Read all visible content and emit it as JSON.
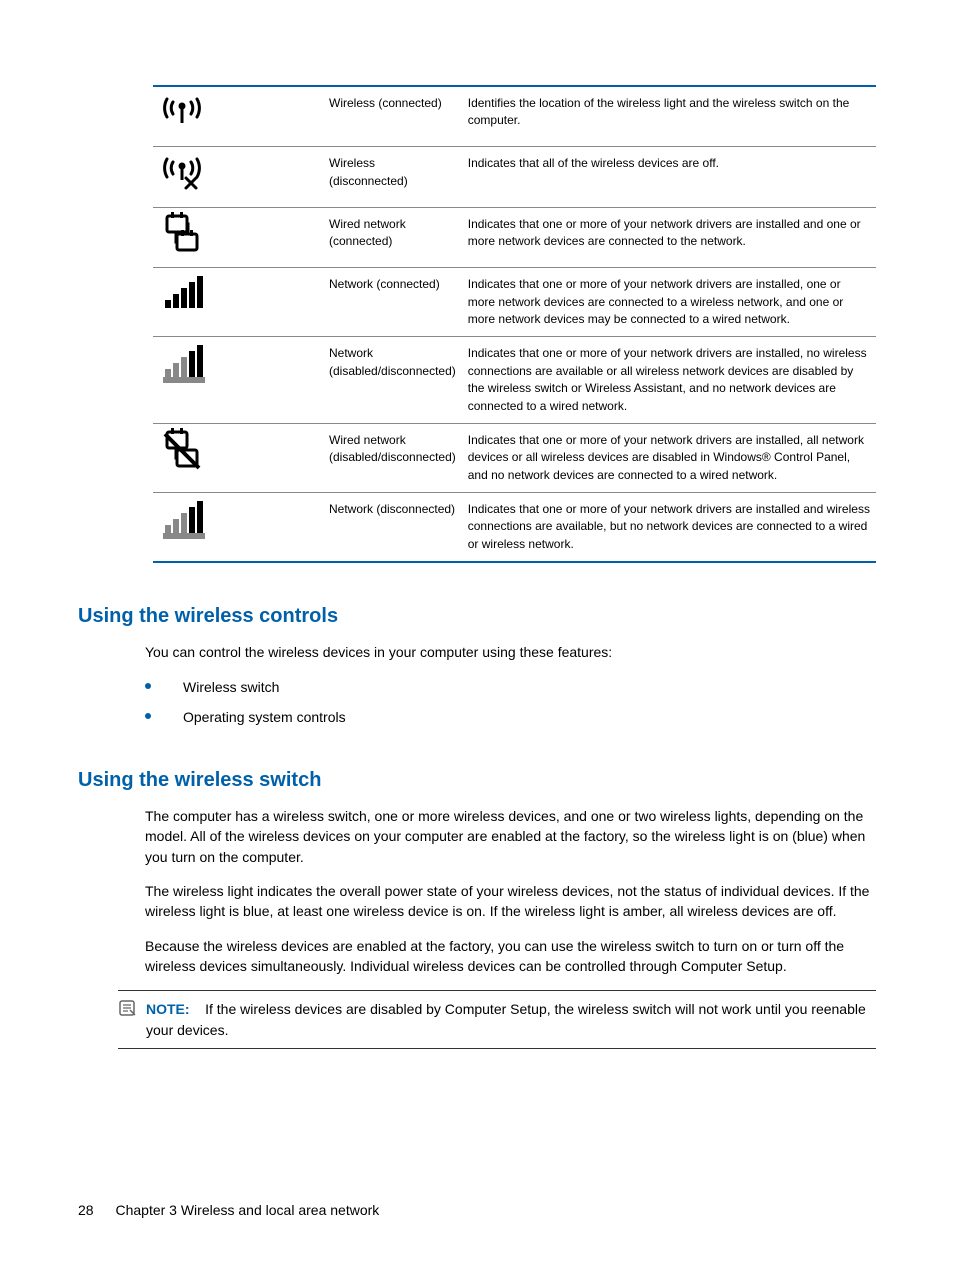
{
  "table": {
    "rows": [
      {
        "name": "Wireless (connected)",
        "desc": "Identifies the location of the wireless light and the wireless switch on the computer."
      },
      {
        "name": "Wireless (disconnected)",
        "desc": "Indicates that all of the wireless devices are off."
      },
      {
        "name": "Wired network (connected)",
        "desc": "Indicates that one or more of your network drivers are installed and one or more network devices are connected to the network."
      },
      {
        "name": "Network (connected)",
        "desc": "Indicates that one or more of your network drivers are installed, one or more network devices are connected to a wireless network, and one or more network devices may be connected to a wired network."
      },
      {
        "name": "Network (disabled/disconnected)",
        "desc": "Indicates that one or more of your network drivers are installed, no wireless connections are available or all wireless network devices are disabled by the wireless switch or Wireless Assistant, and no network devices are connected to a wired network."
      },
      {
        "name": "Wired network (disabled/disconnected)",
        "desc": "Indicates that one or more of your network drivers are installed, all network devices or all wireless devices are disabled in Windows® Control Panel, and no network devices are connected to a wired network."
      },
      {
        "name": "Network (disconnected)",
        "desc": "Indicates that one or more of your network drivers are installed and wireless connections are available, but no network devices are connected to a wired or wireless network."
      }
    ]
  },
  "section1": {
    "heading": "Using the wireless controls",
    "intro": "You can control the wireless devices in your computer using these features:",
    "bullets": [
      "Wireless switch",
      "Operating system controls"
    ]
  },
  "section2": {
    "heading": "Using the wireless switch",
    "p1": "The computer has a wireless switch, one or more wireless devices, and one or two wireless lights, depending on the model. All of the wireless devices on your computer are enabled at the factory, so the wireless light is on (blue) when you turn on the computer.",
    "p2": "The wireless light indicates the overall power state of your wireless devices, not the status of individual devices. If the wireless light is blue, at least one wireless device is on. If the wireless light is amber, all wireless devices are off.",
    "p3": "Because the wireless devices are enabled at the factory, you can use the wireless switch to turn on or turn off the wireless devices simultaneously. Individual wireless devices can be controlled through Computer Setup.",
    "note_label": "NOTE:",
    "note_text": "If the wireless devices are disabled by Computer Setup, the wireless switch will not work until you reenable your devices."
  },
  "footer": {
    "pagenum": "28",
    "chapter": "Chapter 3   Wireless and local area network"
  }
}
